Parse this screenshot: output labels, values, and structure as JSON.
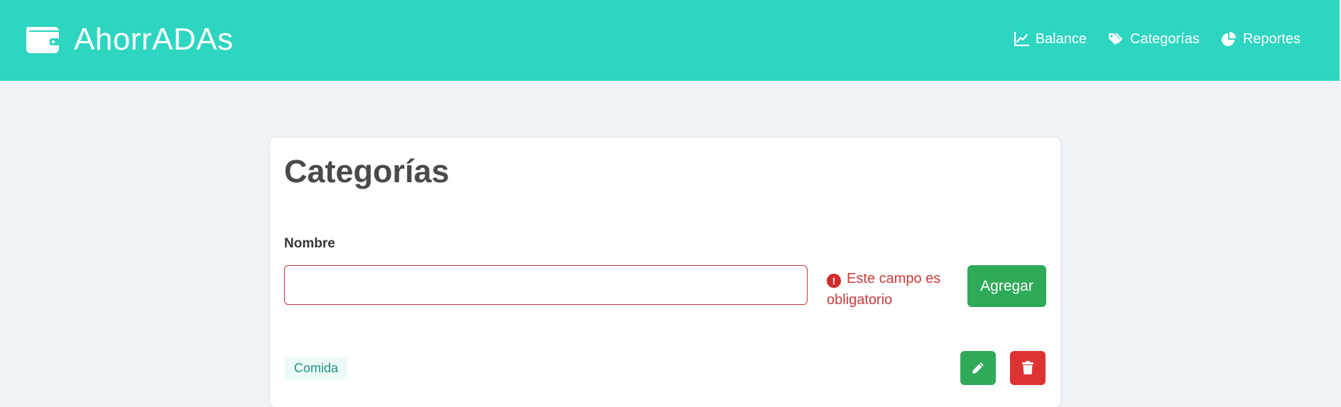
{
  "app": {
    "title": "AhorrADAs",
    "brand_icon": "wallet-icon",
    "colors": {
      "navbar": "#2ed5c1",
      "primary": "#2faa58",
      "danger": "#dd3333",
      "error_text": "#cc3b3b"
    }
  },
  "nav": {
    "items": [
      {
        "label": "Balance",
        "icon": "chart-line-icon"
      },
      {
        "label": "Categorías",
        "icon": "tags-icon"
      },
      {
        "label": "Reportes",
        "icon": "pie-chart-icon"
      }
    ]
  },
  "page": {
    "title": "Categorías",
    "form": {
      "name_label": "Nombre",
      "name_value": "",
      "error_message": "Este campo es obligatorio",
      "error_icon": "exclamation-circle-icon",
      "add_label": "Agregar"
    },
    "categories": [
      {
        "name": "Comida",
        "edit_icon": "pencil-icon",
        "delete_icon": "trash-icon"
      }
    ]
  }
}
